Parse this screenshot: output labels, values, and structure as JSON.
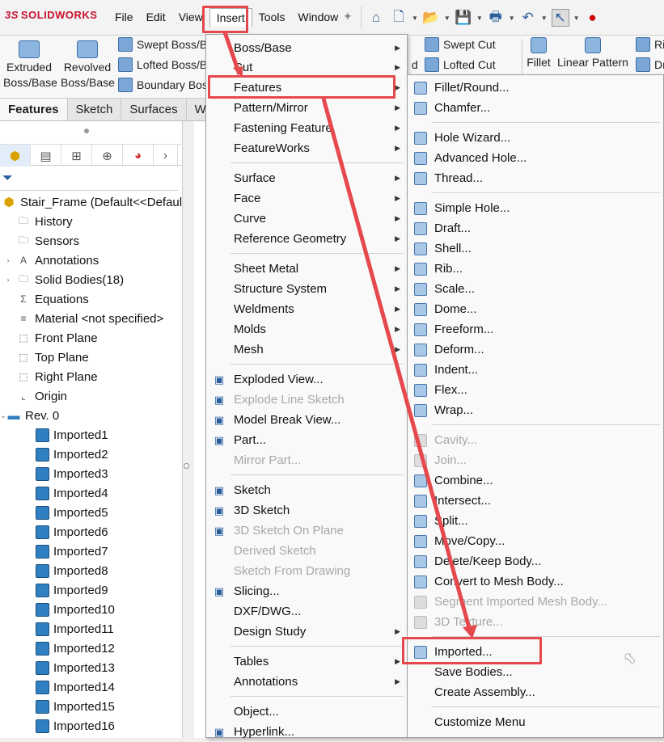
{
  "app": {
    "logo": "SOLIDWORKS",
    "logo_prefix": "3S"
  },
  "menubar": [
    "File",
    "Edit",
    "View",
    "Insert",
    "Tools",
    "Window"
  ],
  "ribbon": {
    "extruded": "Extruded Boss/Base",
    "revolved": "Revolved Boss/Base",
    "swept": "Swept Boss/B",
    "lofted": "Lofted Boss/B",
    "boundary": "Boundary Boss",
    "swept_cut": "Swept Cut",
    "lofted_cut": "Lofted Cut",
    "fillet": "Fillet",
    "linear_pattern": "Linear Pattern",
    "ri": "Ri",
    "dr": "Dr",
    "d": "d"
  },
  "tabs": [
    "Features",
    "Sketch",
    "Surfaces",
    "Welc"
  ],
  "tree": {
    "root": "Stair_Frame  (Default<<Defaul",
    "items": [
      "History",
      "Sensors",
      "Annotations",
      "Solid Bodies(18)",
      "Equations",
      "Material <not specified>",
      "Front Plane",
      "Top Plane",
      "Right Plane",
      "Origin",
      "Rev. 0"
    ],
    "bodies": [
      "Imported1",
      "Imported2",
      "Imported3",
      "Imported4",
      "Imported5",
      "Imported6",
      "Imported7",
      "Imported8",
      "Imported9",
      "Imported10",
      "Imported11",
      "Imported12",
      "Imported13",
      "Imported14",
      "Imported15",
      "Imported16"
    ]
  },
  "insert_menu": [
    "Boss/Base",
    "Cut",
    "Features",
    "Pattern/Mirror",
    "Fastening Feature",
    "FeatureWorks",
    "Surface",
    "Face",
    "Curve",
    "Reference Geometry",
    "Sheet Metal",
    "Structure System",
    "Weldments",
    "Molds",
    "Mesh",
    "Exploded View...",
    "Explode Line Sketch",
    "Model Break View...",
    "Part...",
    "Mirror Part...",
    "Sketch",
    "3D Sketch",
    "3D Sketch On Plane",
    "Derived Sketch",
    "Sketch From Drawing",
    "Slicing...",
    "DXF/DWG...",
    "Design Study",
    "Tables",
    "Annotations",
    "Object...",
    "Hyperlink..."
  ],
  "features_menu": [
    "Fillet/Round...",
    "Chamfer...",
    "Hole Wizard...",
    "Advanced Hole...",
    "Thread...",
    "Simple Hole...",
    "Draft...",
    "Shell...",
    "Rib...",
    "Scale...",
    "Dome...",
    "Freeform...",
    "Deform...",
    "Indent...",
    "Flex...",
    "Wrap...",
    "Cavity...",
    "Join...",
    "Combine...",
    "Intersect...",
    "Split...",
    "Move/Copy...",
    "Delete/Keep Body...",
    "Convert to Mesh Body...",
    "Segment Imported Mesh Body...",
    "3D Texture...",
    "Imported...",
    "Save Bodies...",
    "Create Assembly...",
    "Customize Menu"
  ],
  "colors": {
    "highlight": "#e5484d",
    "accent": "#2a5f9e",
    "body_icon": "#2f7fc1"
  }
}
